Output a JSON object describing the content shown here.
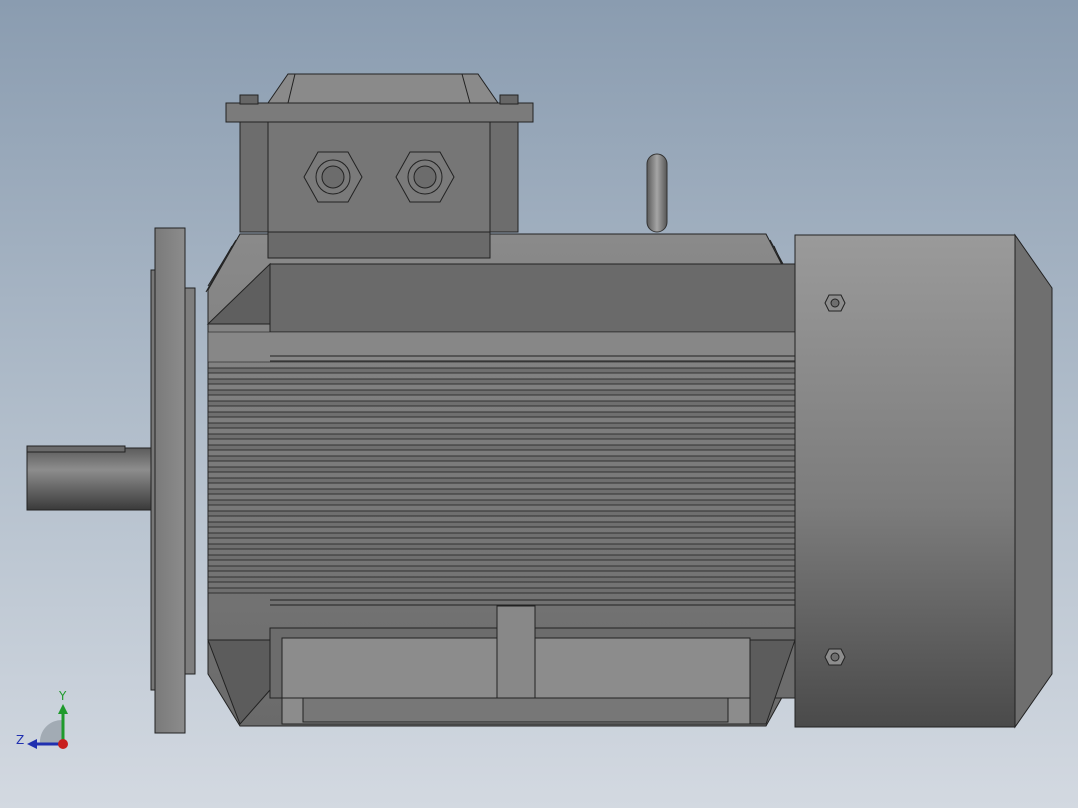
{
  "viewport": {
    "background_top": "#8a9cb0",
    "background_bottom": "#d3d9e1",
    "model": {
      "name": "motor-model"
    }
  },
  "triad": {
    "y_label": "Y",
    "z_label": "Z",
    "y_color": "#1f9a2c",
    "z_color": "#2030b0",
    "x_color": "#c81e1e"
  }
}
